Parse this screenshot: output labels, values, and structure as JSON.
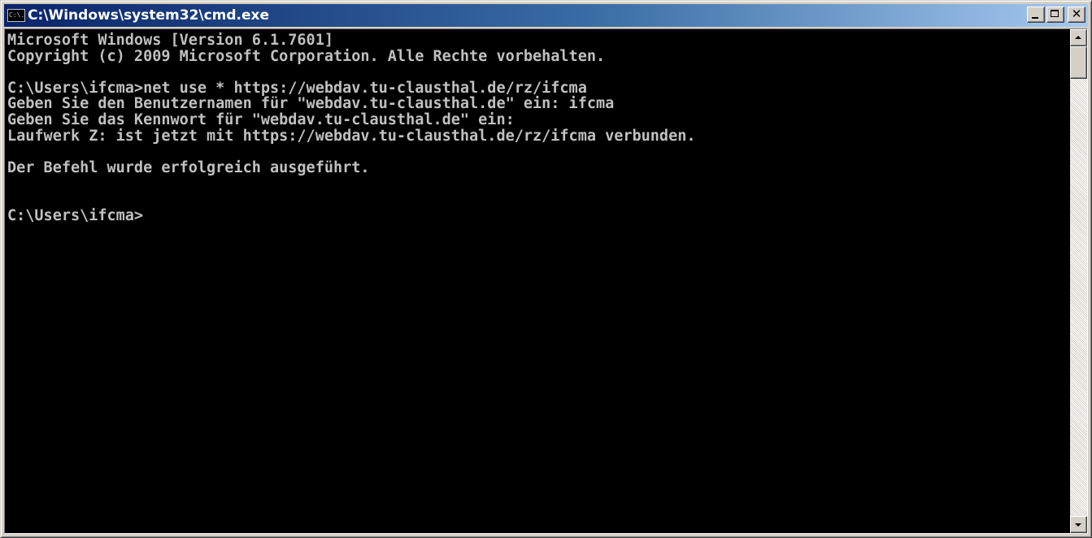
{
  "window": {
    "title": "C:\\Windows\\system32\\cmd.exe",
    "icon_name": "console-app-icon",
    "icon_glyph": "C:\\.",
    "buttons": {
      "minimize": "minimize-icon",
      "maximize": "maximize-icon",
      "close_glyph": "✕"
    }
  },
  "console": {
    "background": "#000000",
    "foreground": "#c0c0c0",
    "lines": [
      "Microsoft Windows [Version 6.1.7601]",
      "Copyright (c) 2009 Microsoft Corporation. Alle Rechte vorbehalten.",
      "",
      "C:\\Users\\ifcma>net use * https://webdav.tu-clausthal.de/rz/ifcma",
      "Geben Sie den Benutzernamen für \"webdav.tu-clausthal.de\" ein: ifcma",
      "Geben Sie das Kennwort für \"webdav.tu-clausthal.de\" ein:",
      "Laufwerk Z: ist jetzt mit https://webdav.tu-clausthal.de/rz/ifcma verbunden.",
      "",
      "Der Befehl wurde erfolgreich ausgeführt.",
      "",
      "",
      "C:\\Users\\ifcma>"
    ]
  },
  "colors": {
    "titlebar_start": "#0a246a",
    "titlebar_end": "#a6caf0",
    "chrome": "#d4d0c8"
  }
}
